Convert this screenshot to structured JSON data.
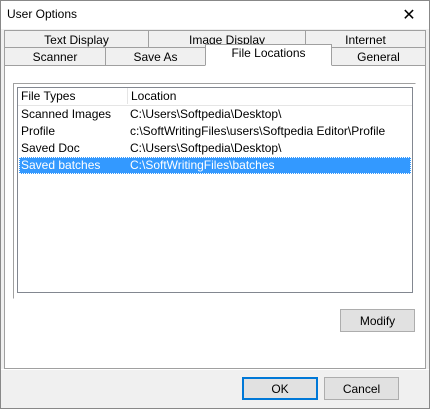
{
  "window": {
    "title": "User Options",
    "close_glyph": "✕"
  },
  "tabs": {
    "row1": [
      "Text Display",
      "Image Display",
      "Internet"
    ],
    "row2": [
      "Scanner",
      "Save As",
      "File Locations",
      "General"
    ],
    "active": "File Locations"
  },
  "list": {
    "headers": [
      "File Types",
      "Location"
    ],
    "rows": [
      {
        "type": "Scanned Images",
        "location": "C:\\Users\\Softpedia\\Desktop\\"
      },
      {
        "type": "Profile",
        "location": "c:\\SoftWritingFiles\\users\\Softpedia Editor\\Profile"
      },
      {
        "type": "Saved Doc",
        "location": "C:\\Users\\Softpedia\\Desktop\\"
      },
      {
        "type": "Saved batches",
        "location": "C:\\SoftWritingFiles\\batches"
      }
    ],
    "selected_index": 3
  },
  "buttons": {
    "modify": "Modify",
    "ok": "OK",
    "cancel": "Cancel"
  },
  "colors": {
    "selection": "#3399ff",
    "ok_border": "#0078d7"
  }
}
